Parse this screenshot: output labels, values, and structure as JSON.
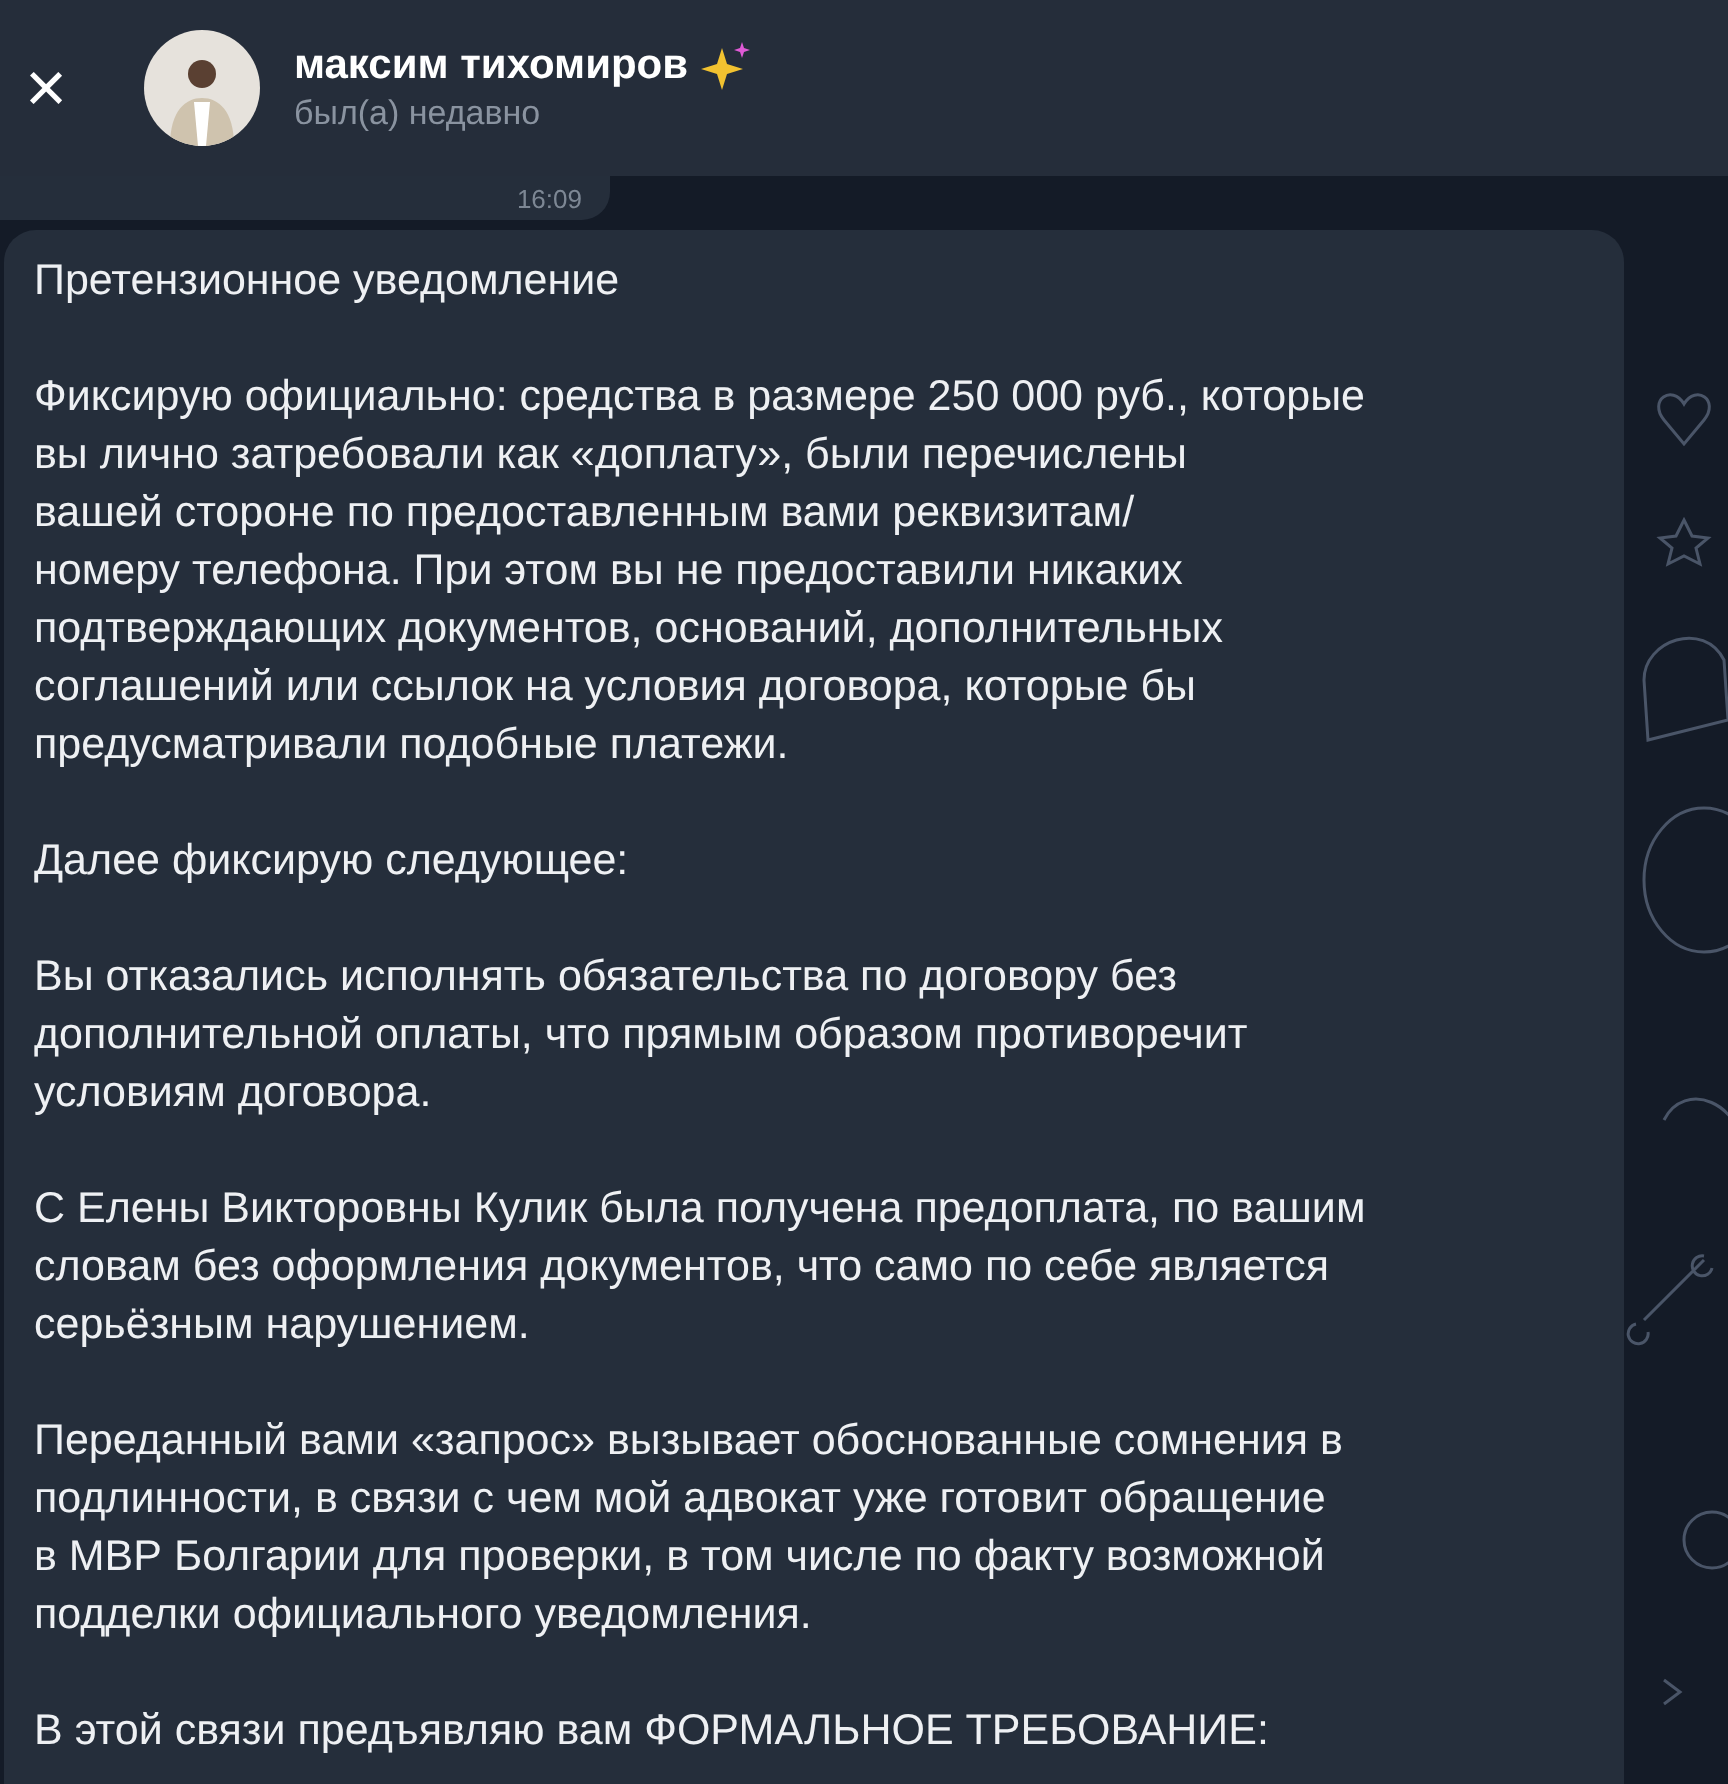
{
  "header": {
    "close": "×",
    "name": "максим тихомиров",
    "status": "был(а) недавно"
  },
  "previous_message": {
    "time": "16:09"
  },
  "message": {
    "paragraphs": [
      {
        "lines": [
          "Претензионное уведомление"
        ]
      },
      {
        "lines": [
          "Фиксирую официально: средства в размере 250 000 руб., которые",
          "вы лично затребовали как «доплату», были перечислены",
          "вашей стороне по предоставленным вами реквизитам/",
          "номеру телефона. При этом вы не предоставили никаких",
          "подтверждающих документов, оснований, дополнительных",
          "соглашений или ссылок на условия договора, которые бы",
          "предусматривали подобные платежи."
        ]
      },
      {
        "lines": [
          "Далее фиксирую следующее:"
        ]
      },
      {
        "lines": [
          "Вы отказались исполнять обязательства по договору без",
          "дополнительной оплаты, что прямым образом противоречит",
          "условиям договора."
        ]
      },
      {
        "lines": [
          "С Елены Викторовны Кулик была получена предоплата, по вашим",
          "словам без оформления документов, что само по себе является",
          "серьёзным нарушением."
        ]
      },
      {
        "lines": [
          "Переданный вами «запрос» вызывает обоснованные сомнения в",
          "подлинности, в связи с чем мой адвокат уже готовит обращение",
          "в МВР Болгарии для проверки, в том числе по факту возможной",
          "подделки официального уведомления."
        ]
      },
      {
        "lines": [
          "В этой связи предъявляю вам ФОРМАЛЬНОЕ ТРЕБОВАНИЕ:"
        ]
      }
    ]
  }
}
